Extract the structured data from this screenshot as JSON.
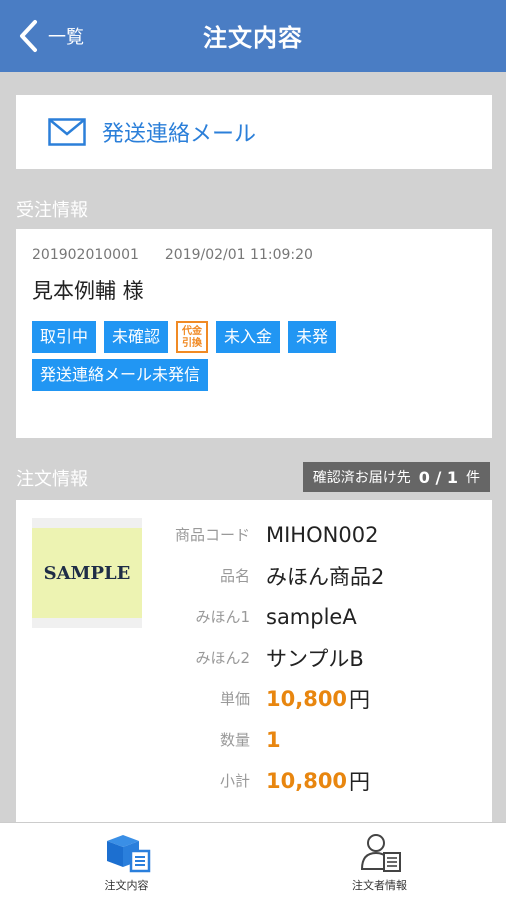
{
  "header": {
    "back_label": "一覧",
    "title": "注文内容"
  },
  "mail_button": {
    "label": "発送連絡メール",
    "icon": "envelope-icon"
  },
  "order_section": {
    "label": "受注情報",
    "order_number": "201902010001",
    "datetime": "2019/02/01 11:09:20",
    "customer": "見本例輔 様",
    "badges": {
      "trading": "取引中",
      "unconfirmed": "未確認",
      "cod_line1": "代金",
      "cod_line2": "引換",
      "unpaid": "未入金",
      "unshipped": "未発",
      "mail_unsent": "発送連絡メール未発信"
    }
  },
  "order_info": {
    "label": "注文情報",
    "confirmed_label": "確認済お届け先",
    "confirmed_count": "0 / 1",
    "confirmed_unit": "件"
  },
  "item": {
    "thumbnail_text": "SAMPLE",
    "fields": {
      "code_label": "商品コード",
      "code": "MIHON002",
      "name_label": "品名",
      "name": "みほん商品2",
      "opt1_label": "みほん1",
      "opt1": "sampleA",
      "opt2_label": "みほん2",
      "opt2": "サンプルB",
      "price_label": "単価",
      "price": "10,800",
      "qty_label": "数量",
      "qty": "1",
      "subtotal_label": "小計",
      "subtotal": "10,800",
      "currency": "円"
    }
  },
  "tabbar": {
    "tabs": [
      {
        "label": "注文内容",
        "icon": "box-list-icon",
        "active": true
      },
      {
        "label": "注文者情報",
        "icon": "person-card-icon",
        "active": false
      }
    ]
  },
  "colors": {
    "header": "#4a7dc4",
    "accent_blue": "#2196f3",
    "link_blue": "#2b7fd9",
    "price_orange": "#e8860f",
    "cod_orange": "#f08a24",
    "background": "#d2d2d2"
  }
}
